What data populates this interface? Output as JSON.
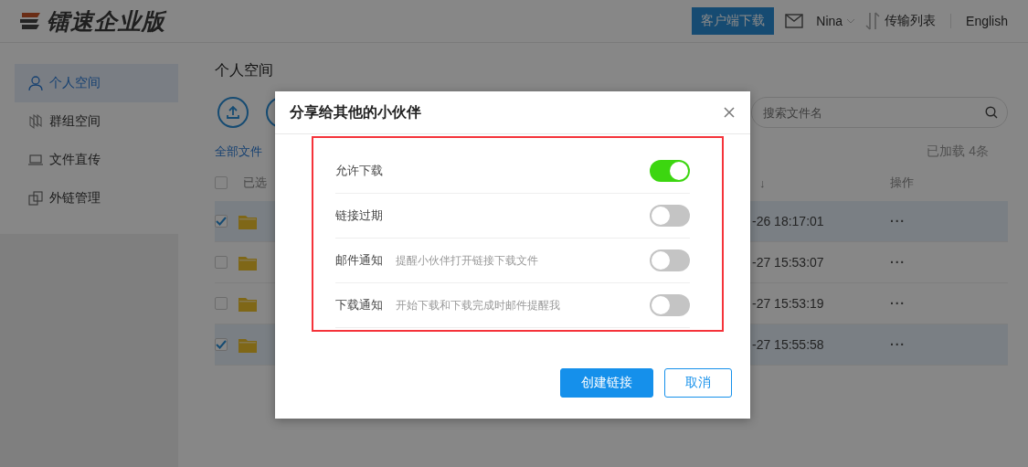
{
  "header": {
    "logo_text": "镭速企业版",
    "download_button": "客户端下载",
    "user": "Nina",
    "transfer_list": "传输列表",
    "language": "English"
  },
  "sidebar": {
    "items": [
      {
        "label": "个人空间",
        "kind": "person",
        "selected": true
      },
      {
        "label": "群组空间",
        "kind": "group",
        "selected": false
      },
      {
        "label": "文件直传",
        "kind": "laptop",
        "selected": false
      },
      {
        "label": "外链管理",
        "kind": "link",
        "selected": false
      }
    ]
  },
  "page_title": "个人空间",
  "search": {
    "placeholder": "搜索文件名"
  },
  "breadcrumb": "全部文件",
  "loaded_count": "已加载 4条",
  "table": {
    "select_all_checked": false,
    "columns": [
      "已选",
      "↓",
      "操作"
    ],
    "rows": [
      {
        "checked": true,
        "date": "-26 18:17:01",
        "actions": "···"
      },
      {
        "checked": false,
        "date": "-27 15:53:07",
        "actions": "···"
      },
      {
        "checked": false,
        "date": "-27 15:53:19",
        "actions": "···"
      },
      {
        "checked": true,
        "date": "-27 15:55:58",
        "actions": "···"
      }
    ]
  },
  "dialog": {
    "title": "分享给其他的小伙伴",
    "options": [
      {
        "label": "允许下载",
        "on": true
      },
      {
        "label": "链接过期",
        "on": false
      },
      {
        "label": "邮件通知",
        "hint": "提醒小伙伴打开链接下载文件",
        "on": false
      },
      {
        "label": "下载通知",
        "hint": "开始下载和下载完成时邮件提醒我",
        "on": false
      }
    ],
    "buttons": [
      {
        "label": "创建链接",
        "kind": "primary"
      },
      {
        "label": "取消",
        "kind": "secondary"
      }
    ]
  }
}
